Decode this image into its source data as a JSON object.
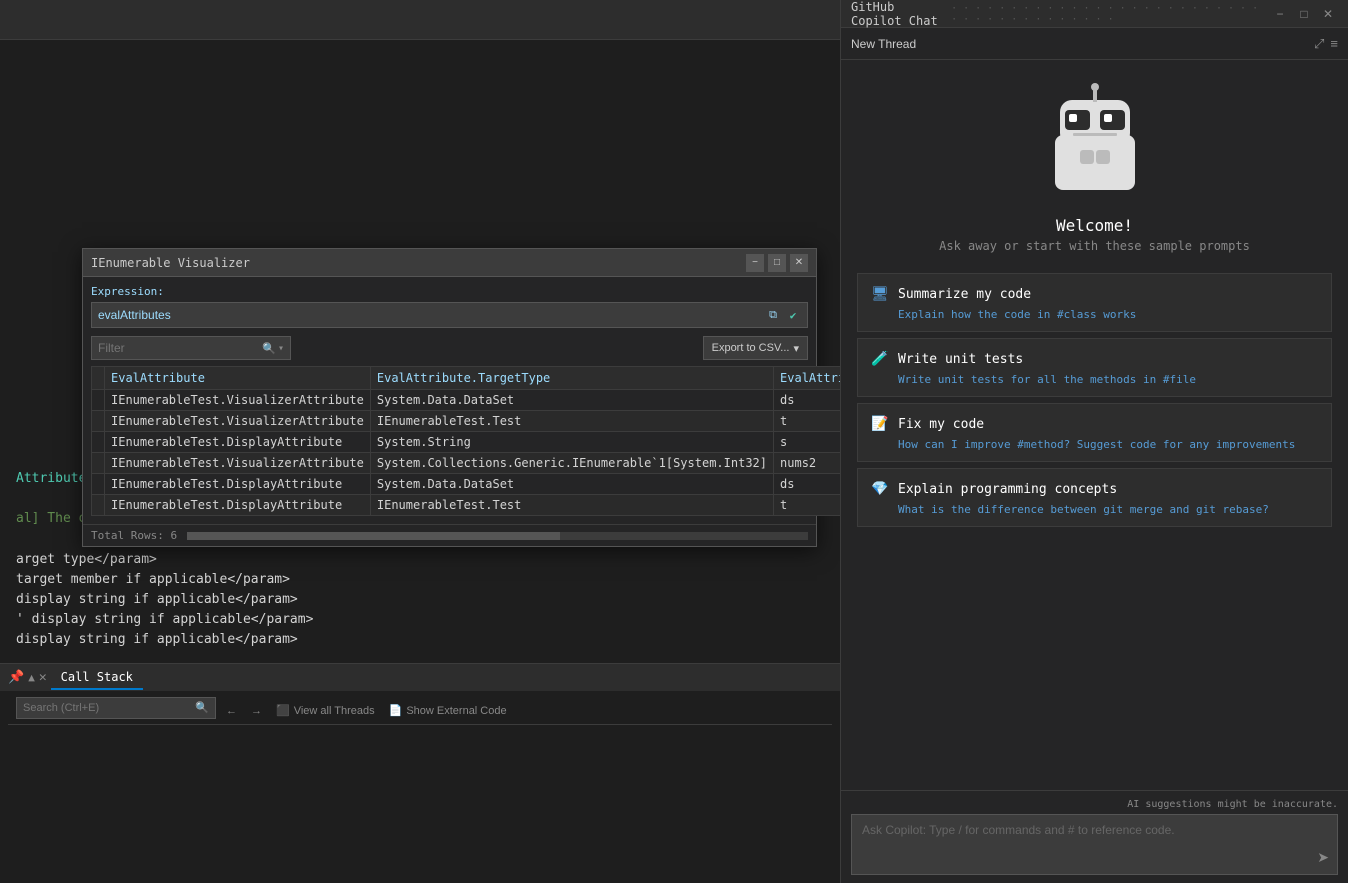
{
  "editor": {
    "code_lines": [
      {
        "text": "Attribute class",
        "color": "teal"
      },
      {
        "text": "",
        "color": "white"
      },
      {
        "text": "al] The originating assembly if this DisplayAttribute came from an",
        "color": "green"
      },
      {
        "text": "",
        "color": "white"
      },
      {
        "text": "arget type</param>",
        "color": "white"
      },
      {
        "text": "target member if applicable</param>",
        "color": "white"
      },
      {
        "text": "display string if applicable</param>",
        "color": "white"
      },
      {
        "text": "' display string if applicable</param>",
        "color": "white"
      },
      {
        "text": "display string if applicable</param>",
        "color": "white"
      }
    ]
  },
  "visualizer": {
    "title": "IEnumerable Visualizer",
    "expression_label": "Expression:",
    "expression_value": "evalAttributes",
    "filter_placeholder": "Filter",
    "export_button": "Export to CSV...",
    "columns": [
      {
        "key": "EvalAttribute",
        "label": "EvalAttribute"
      },
      {
        "key": "TargetType",
        "label": "EvalAttribute.TargetType"
      },
      {
        "key": "TargetMember",
        "label": "EvalAttribute.TargetMember"
      }
    ],
    "rows": [
      {
        "index": "",
        "col1": "IEnumerableTest.VisualizerAttribute",
        "col2": "System.Data.DataSet",
        "col3": "ds"
      },
      {
        "index": "",
        "col1": "IEnumerableTest.VisualizerAttribute",
        "col2": "IEnumerableTest.Test",
        "col3": "t"
      },
      {
        "index": "",
        "col1": "IEnumerableTest.DisplayAttribute",
        "col2": "System.String",
        "col3": "s"
      },
      {
        "index": "",
        "col1": "IEnumerableTest.VisualizerAttribute",
        "col2": "System.Collections.Generic.IEnumerable`1[System.Int32]",
        "col3": "nums2"
      },
      {
        "index": "",
        "col1": "IEnumerableTest.DisplayAttribute",
        "col2": "System.Data.DataSet",
        "col3": "ds"
      },
      {
        "index": "",
        "col1": "IEnumerableTest.DisplayAttribute",
        "col2": "IEnumerableTest.Test",
        "col3": "t"
      }
    ],
    "total_rows": "Total Rows: 6",
    "window_controls": {
      "minimize": "−",
      "restore": "□",
      "close": "✕"
    }
  },
  "bottom_panel": {
    "tab_label": "Call Stack",
    "search_placeholder": "Search (Ctrl+E)",
    "view_all_threads_label": "View all Threads",
    "show_external_code_label": "Show External Code",
    "nav_back": "←",
    "nav_forward": "→"
  },
  "copilot": {
    "title": "GitHub Copilot Chat",
    "new_thread_label": "New Thread",
    "welcome_title": "Welcome!",
    "welcome_subtitle": "Ask away or start with these sample prompts",
    "ai_disclaimer": "AI suggestions might be inaccurate.",
    "input_placeholder": "Ask Copilot: Type / for commands and # to reference code.",
    "controls": {
      "minimize": "−",
      "restore": "□",
      "close": "✕",
      "expand": "⤢",
      "settings": "≡"
    },
    "prompts": [
      {
        "id": "summarize",
        "icon": "🖥",
        "icon_color": "#569cd6",
        "title": "Summarize my code",
        "description": "Explain how the code in #class works"
      },
      {
        "id": "unit_tests",
        "icon": "🧪",
        "icon_color": "#4ec9b0",
        "title": "Write unit tests",
        "description": "Write unit tests for all the methods in #file"
      },
      {
        "id": "fix_code",
        "icon": "📝",
        "icon_color": "#d7ba7d",
        "title": "Fix my code",
        "description": "How can I improve #method? Suggest code for any improvements"
      },
      {
        "id": "explain_concepts",
        "icon": "💎",
        "icon_color": "#f14c4c",
        "title": "Explain programming concepts",
        "description": "What is the difference between git merge and git rebase?"
      }
    ]
  }
}
